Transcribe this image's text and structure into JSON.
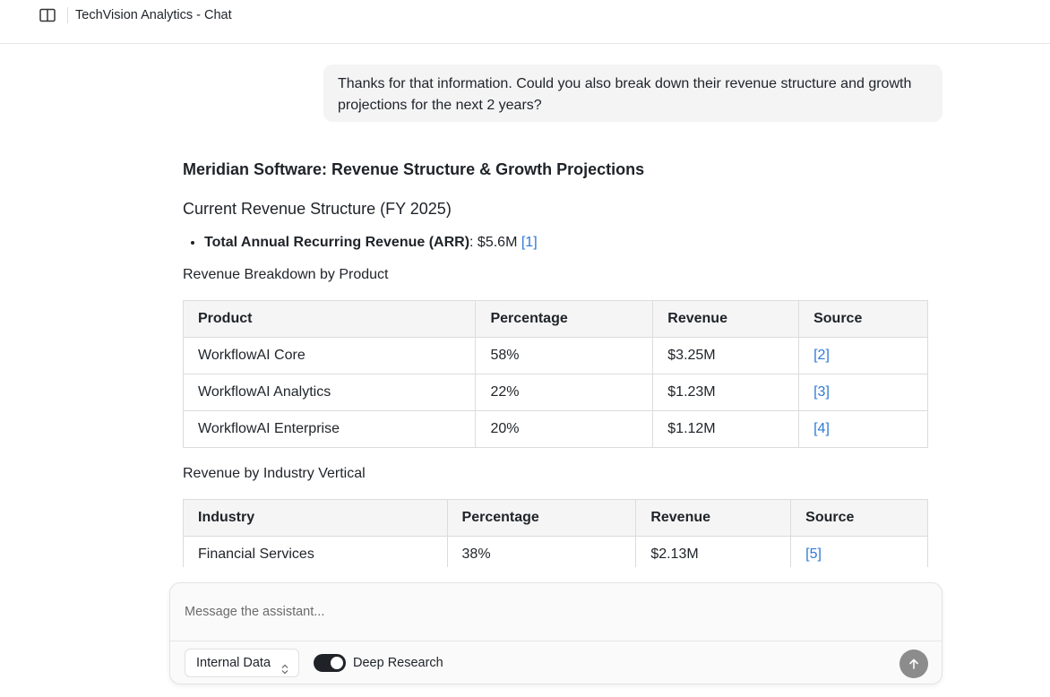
{
  "header": {
    "title": "TechVision Analytics - Chat"
  },
  "conversation": {
    "user_message": "Thanks for that information. Could you also break down their revenue structure and growth projections for the next 2 years?",
    "response": {
      "title": "Meridian Software: Revenue Structure & Growth Projections",
      "subtitle": "Current Revenue Structure (FY 2025)",
      "bullet": {
        "label": "Total Annual Recurring Revenue (ARR)",
        "value": ": $5.6M ",
        "cite": "[1]"
      },
      "product_section": {
        "heading": "Revenue Breakdown by Product",
        "columns": [
          "Product",
          "Percentage",
          "Revenue",
          "Source"
        ],
        "rows": [
          {
            "name": "WorkflowAI Core",
            "pct": "58%",
            "revenue": "$3.25M",
            "cite": "[2]"
          },
          {
            "name": "WorkflowAI Analytics",
            "pct": "22%",
            "revenue": "$1.23M",
            "cite": "[3]"
          },
          {
            "name": "WorkflowAI Enterprise",
            "pct": "20%",
            "revenue": "$1.12M",
            "cite": "[4]"
          }
        ]
      },
      "industry_section": {
        "heading": "Revenue by Industry Vertical",
        "columns": [
          "Industry",
          "Percentage",
          "Revenue",
          "Source"
        ],
        "rows": [
          {
            "name": "Financial Services",
            "pct": "38%",
            "revenue": "$2.13M",
            "cite": "[5]"
          }
        ]
      }
    }
  },
  "composer": {
    "placeholder": "Message the assistant...",
    "source_select": "Internal Data",
    "deep_research_label": "Deep Research",
    "deep_research_on": true
  },
  "colors": {
    "link": "#2f7ad6",
    "toggle_on": "#1f2328",
    "send_button": "#8c8c8c"
  }
}
